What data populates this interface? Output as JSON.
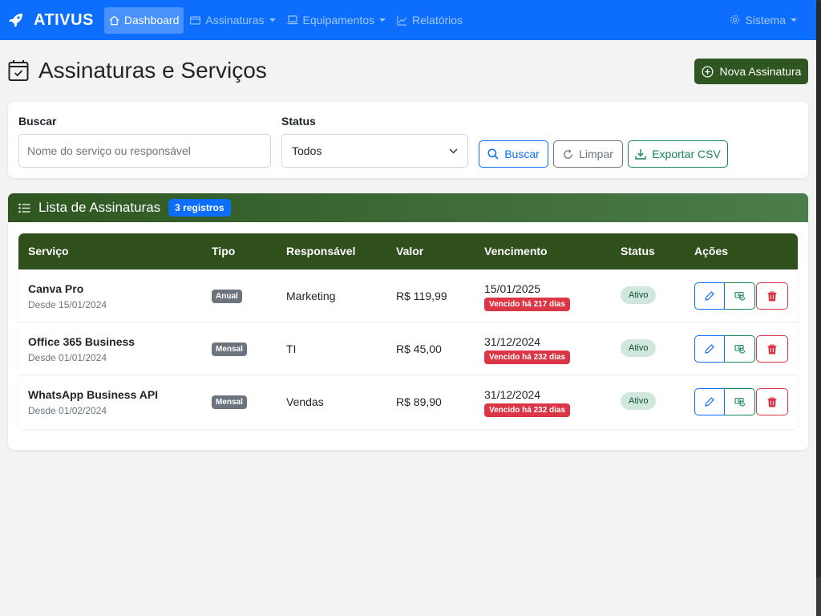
{
  "navbar": {
    "brand": "ATIVUS",
    "items": [
      {
        "label": "Dashboard",
        "icon": "home-icon"
      },
      {
        "label": "Assinaturas",
        "icon": "card-icon"
      },
      {
        "label": "Equipamentos",
        "icon": "laptop-icon"
      },
      {
        "label": "Relatórios",
        "icon": "chart-line-icon"
      }
    ],
    "right_label": "Sistema",
    "colors": {
      "background": "#0d6efd"
    }
  },
  "page": {
    "title": "Assinaturas e Serviços",
    "new_button": "Nova Assinatura"
  },
  "filters": {
    "search_label": "Buscar",
    "search_placeholder": "Nome do serviço ou responsável",
    "status_label": "Status",
    "status_value": "Todos",
    "btn_search": "Buscar",
    "btn_clear": "Limpar",
    "btn_export": "Exportar CSV"
  },
  "list": {
    "title": "Lista de Assinaturas",
    "count_badge": "3 registros",
    "columns": [
      "Serviço",
      "Tipo",
      "Responsável",
      "Valor",
      "Vencimento",
      "Status",
      "Ações"
    ],
    "rows": [
      {
        "name": "Canva Pro",
        "since": "Desde 15/01/2024",
        "type": "Anual",
        "owner": "Marketing",
        "value": "R$ 119,99",
        "due": "15/01/2025",
        "due_badge": "Vencido há 217 dias",
        "status": "Ativo"
      },
      {
        "name": "Office 365 Business",
        "since": "Desde 01/01/2024",
        "type": "Mensal",
        "owner": "TI",
        "value": "R$ 45,00",
        "due": "31/12/2024",
        "due_badge": "Vencido há 232 dias",
        "status": "Ativo"
      },
      {
        "name": "WhatsApp Business API",
        "since": "Desde 01/02/2024",
        "type": "Mensal",
        "owner": "Vendas",
        "value": "R$ 89,90",
        "due": "31/12/2024",
        "due_badge": "Vencido há 232 dias",
        "status": "Ativo"
      }
    ]
  },
  "colors": {
    "primary": "#0d6efd",
    "dark_green": "#2f5620",
    "danger": "#dc3545",
    "success": "#198754"
  }
}
